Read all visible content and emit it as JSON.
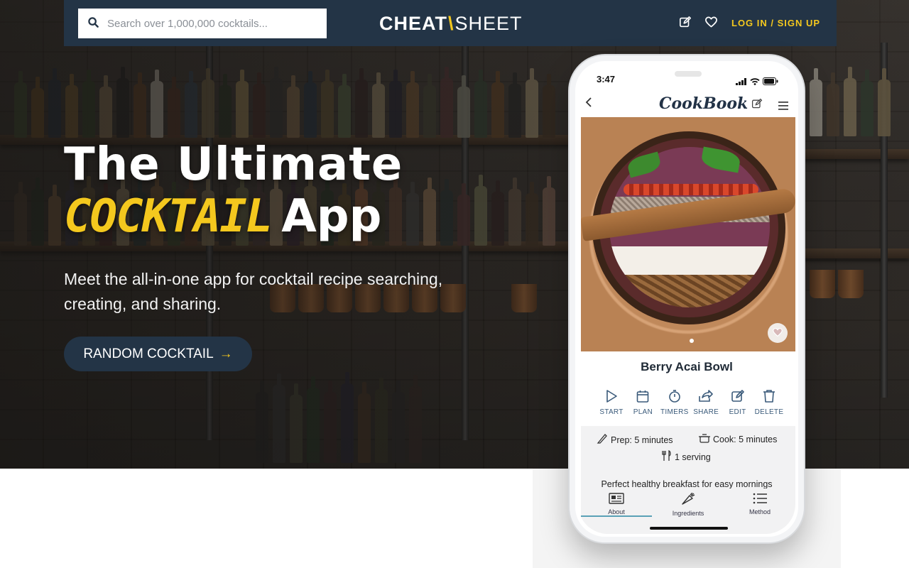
{
  "header": {
    "search_placeholder": "Search over 1,000,000 cocktails...",
    "logo_bold": "CHEAT",
    "logo_slash": "\\",
    "logo_light": "SHEET",
    "login_label": "LOG IN / SIGN UP",
    "icons": [
      "search-icon",
      "edit-icon",
      "heart-icon"
    ]
  },
  "hero": {
    "headline_line1": "The Ultimate",
    "headline_accent": "COCKTAIL",
    "headline_rest": "App",
    "subtitle": "Meet the all-in-one app for cocktail recipe searching, creating, and sharing.",
    "cta_label": "RANDOM COCKTAIL",
    "cta_arrow": "→"
  },
  "phone": {
    "status_time": "3:47",
    "app_logo": "CookBook",
    "recipe_title": "Berry Acai Bowl",
    "actions": [
      {
        "label": "START",
        "icon": "play-icon"
      },
      {
        "label": "PLAN",
        "icon": "calendar-icon"
      },
      {
        "label": "TIMERS",
        "icon": "timer-icon"
      },
      {
        "label": "SHARE",
        "icon": "share-icon"
      },
      {
        "label": "EDIT",
        "icon": "edit-icon"
      },
      {
        "label": "DELETE",
        "icon": "trash-icon"
      }
    ],
    "prep": "Prep: 5 minutes",
    "cook": "Cook: 5 minutes",
    "servings": "1 serving",
    "description": "Perfect healthy breakfast for easy mornings",
    "tabs": [
      {
        "label": "About",
        "icon": "newspaper-icon"
      },
      {
        "label": "Ingredients",
        "icon": "carrot-icon"
      },
      {
        "label": "Method",
        "icon": "list-icon"
      }
    ]
  },
  "colors": {
    "navy": "#233446",
    "accent_yellow": "#f4c81e"
  }
}
